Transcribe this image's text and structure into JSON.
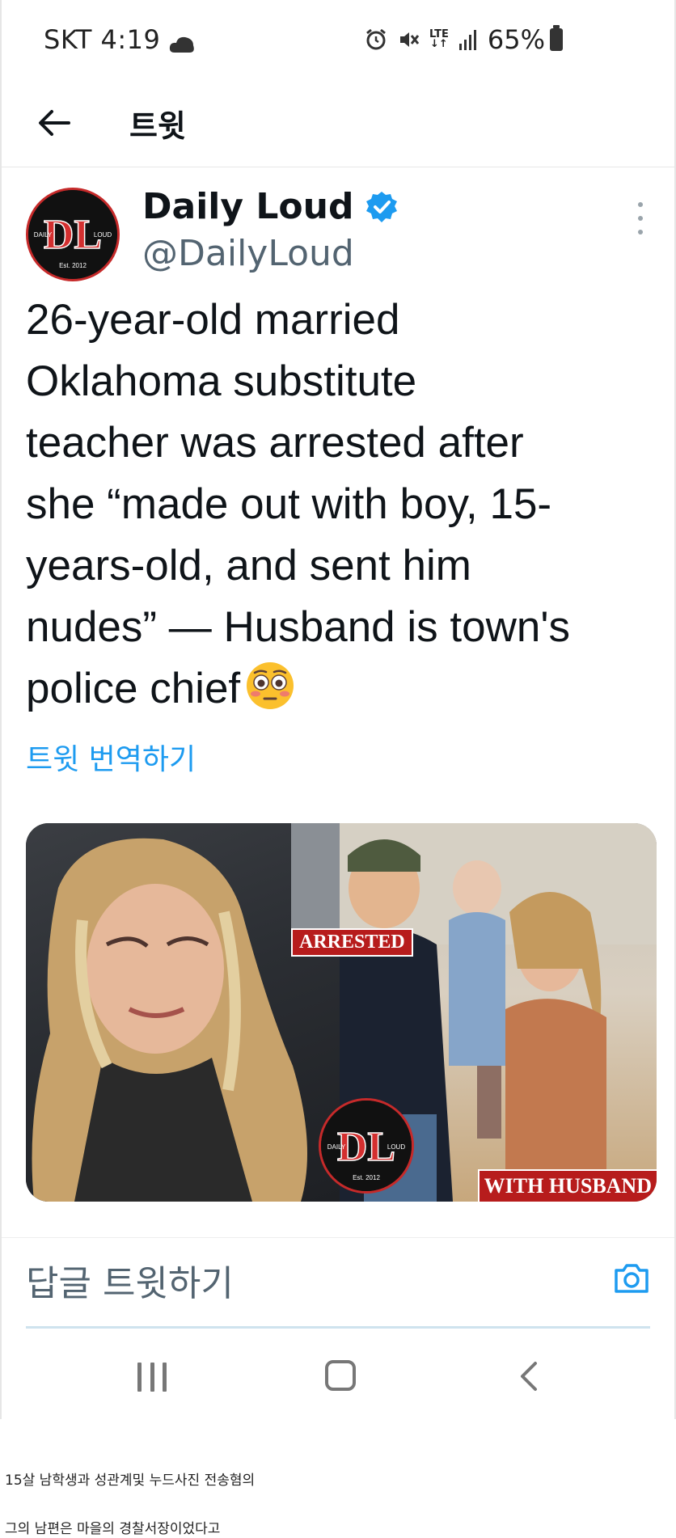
{
  "status_bar": {
    "carrier_time": "SKT 4:19",
    "network": "LTE",
    "battery": "65%",
    "icons": [
      "cloud-icon",
      "alarm-icon",
      "mute-icon",
      "lte-icon",
      "signal-icon",
      "battery-icon"
    ]
  },
  "header": {
    "title": "트윗"
  },
  "tweet": {
    "author_name": "Daily Loud",
    "author_handle": "@DailyLoud",
    "avatar_initials": "DL",
    "avatar_left": "DAILY",
    "avatar_right": "LOUD",
    "avatar_est": "Est. 2012",
    "text_lines": [
      "26-year-old married",
      "Oklahoma substitute",
      "teacher was arrested after",
      "she “made out with boy, 15-",
      "years-old, and sent him",
      "nudes” — Husband is town's",
      "police chief"
    ],
    "emoji": "flushed-face",
    "translate_label": "트윗 번역하기",
    "media": {
      "badge_arrested": "ARRESTED",
      "badge_husband": "WITH HUSBAND",
      "logo_initials": "DL",
      "logo_left": "DAILY",
      "logo_right": "LOUD",
      "logo_est": "Est. 2012"
    }
  },
  "reply": {
    "placeholder": "답글 트윗하기"
  },
  "captions": [
    "15살 남학생과 성관계및 누드사진 전송혐의",
    "그의 남편은 마을의 경찰서장이었다고"
  ],
  "colors": {
    "accent": "#1d9bf0",
    "text": "#0f1419",
    "secondary": "#536471",
    "badge_red": "#b71c1c"
  }
}
